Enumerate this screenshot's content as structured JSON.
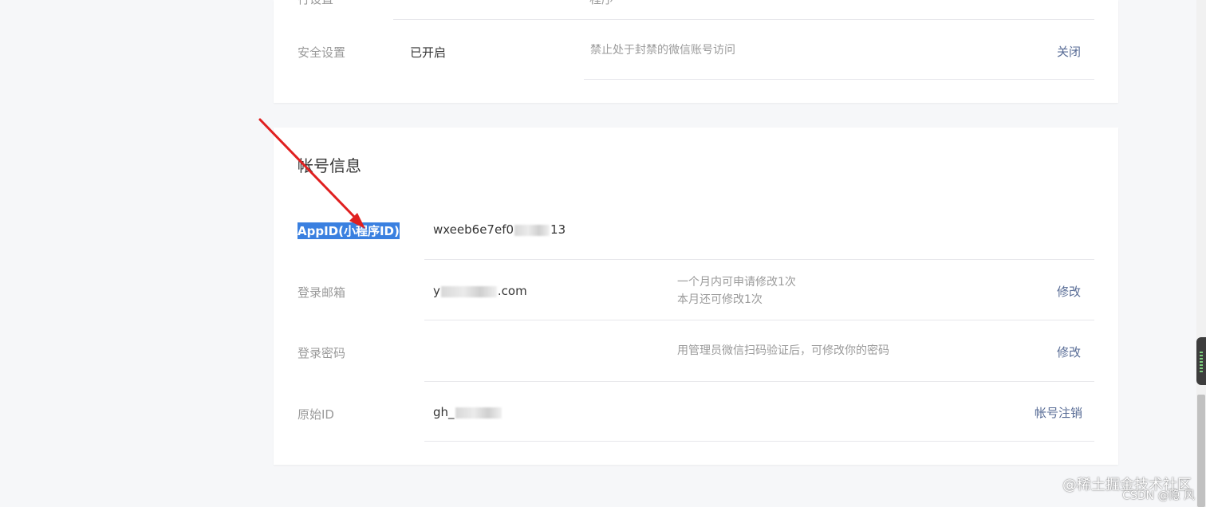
{
  "top_card": {
    "cut_label": "行设置",
    "cut_value": "程序",
    "security": {
      "label": "安全设置",
      "value": "已开启",
      "desc": "禁止处于封禁的微信账号访问",
      "action": "关闭"
    }
  },
  "account": {
    "title": "帐号信息",
    "appid": {
      "label": "AppID(小程序ID)",
      "value_prefix": "wxeeb6e7ef0",
      "value_suffix": "13"
    },
    "email": {
      "label": "登录邮箱",
      "value_prefix": "y",
      "value_suffix": ".com",
      "desc_line1": "一个月内可申请修改1次",
      "desc_line2": "本月还可修改1次",
      "action": "修改"
    },
    "password": {
      "label": "登录密码",
      "desc": "用管理员微信扫码验证后，可修改你的密码",
      "action": "修改"
    },
    "original_id": {
      "label": "原始ID",
      "value_prefix": "gh_",
      "action": "帐号注销"
    }
  },
  "annotation": {
    "arrow_color": "#e02020"
  },
  "watermark": {
    "line1": "@稀土掘金技术社区",
    "line2": "CSDN @隐 风"
  }
}
